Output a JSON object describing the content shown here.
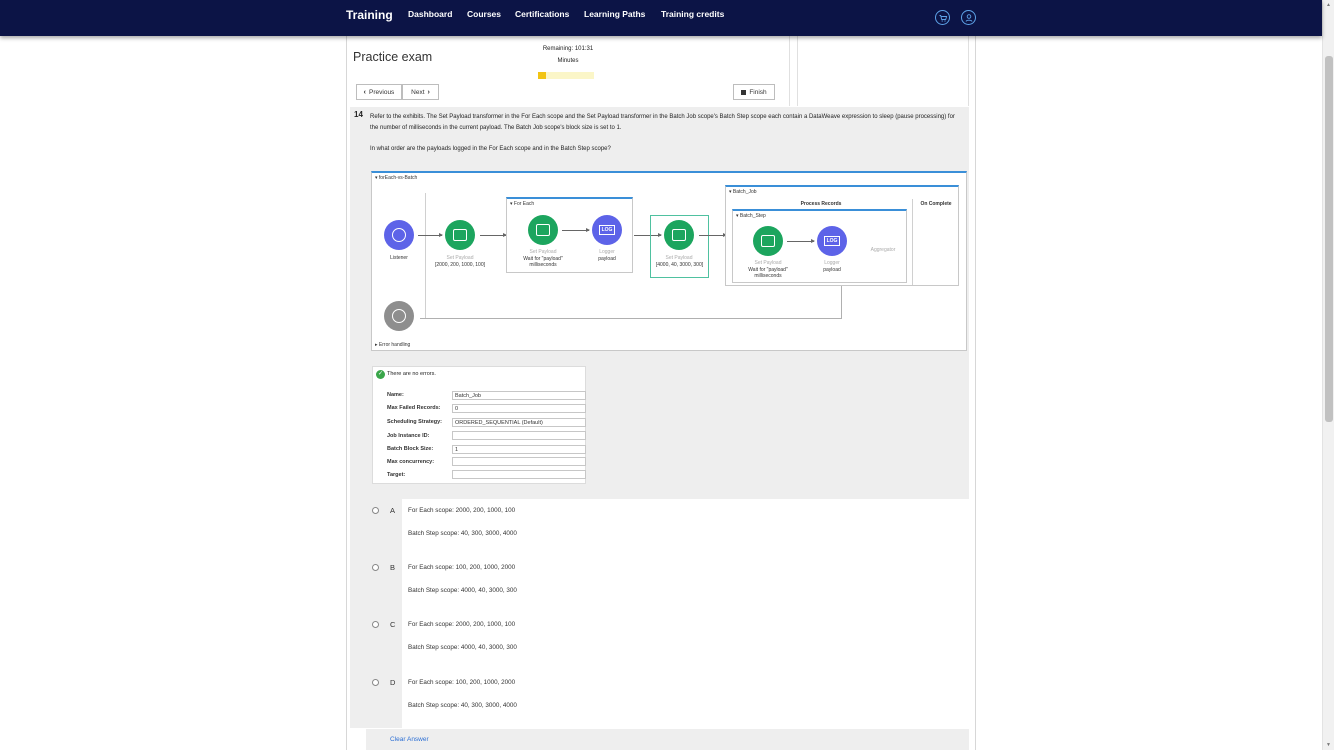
{
  "nav": {
    "brand": "Training",
    "items": [
      "Dashboard",
      "Courses",
      "Certifications",
      "Learning Paths",
      "Training credits"
    ],
    "icons": [
      "cart-icon",
      "user-icon"
    ]
  },
  "exam": {
    "title": "Practice exam",
    "remaining": "Remaining: 101:31",
    "minutes": "Minutes",
    "time_progress": 0.14,
    "previous_label": "Previous",
    "next_label": "Next",
    "finish_label": "Finish"
  },
  "question": {
    "number": "14",
    "text": "Refer to the exhibits. The Set Payload transformer in the For Each scope and the Set Payload transformer in the Batch Job scope's Batch Step scope each contain a DataWeave expression to sleep (pause processing) for the number of milliseconds in the current payload. The Batch Job scope's block size is set to 1.",
    "prompt": "In what order are the payloads logged in the For Each scope and in the Batch Step scope?"
  },
  "diagram": {
    "flow_name": "forEach-vs-Batch",
    "listener_label": "Listener",
    "set_payload_label": "Set Payload",
    "set_payload_1_value": "[2000, 200, 1000, 100]",
    "for_each_label": "For Each",
    "wait_label": "Wait for \"payload\" milliseconds",
    "logger_label": "Logger",
    "payload_label": "payload",
    "set_payload_2_value": "[4000, 40, 3000, 300]",
    "batch_job_label": "Batch_Job",
    "process_records_label": "Process Records",
    "on_complete_label": "On Complete",
    "batch_step_label": "Batch_Step",
    "aggregator_label": "Aggregator",
    "error_handling_label": "Error handling",
    "log_glyph": "LOG"
  },
  "properties": {
    "status": "There are no errors.",
    "fields": [
      {
        "label": "Name:",
        "value": "Batch_Job"
      },
      {
        "label": "Max Failed Records:",
        "value": "0"
      },
      {
        "label": "Scheduling Strategy:",
        "value": "ORDERED_SEQUENTIAL (Default)"
      },
      {
        "label": "Job Instance ID:",
        "value": ""
      },
      {
        "label": "Batch Block Size:",
        "value": "1"
      },
      {
        "label": "Max concurrency:",
        "value": ""
      },
      {
        "label": "Target:",
        "value": ""
      }
    ]
  },
  "answers": [
    {
      "letter": "A",
      "line1": "For Each scope: 2000, 200, 1000, 100",
      "line2": "Batch Step scope: 40, 300, 3000, 4000"
    },
    {
      "letter": "B",
      "line1": "For Each scope: 100, 200, 1000, 2000",
      "line2": "Batch Step scope: 4000, 40, 3000, 300"
    },
    {
      "letter": "C",
      "line1": "For Each scope: 2000, 200, 1000, 100",
      "line2": "Batch Step scope: 4000, 40, 3000, 300"
    },
    {
      "letter": "D",
      "line1": "For Each scope: 100, 200, 1000, 2000",
      "line2": "Batch Step scope: 40, 300, 3000, 4000"
    }
  ],
  "clear_answer_label": "Clear Answer"
}
